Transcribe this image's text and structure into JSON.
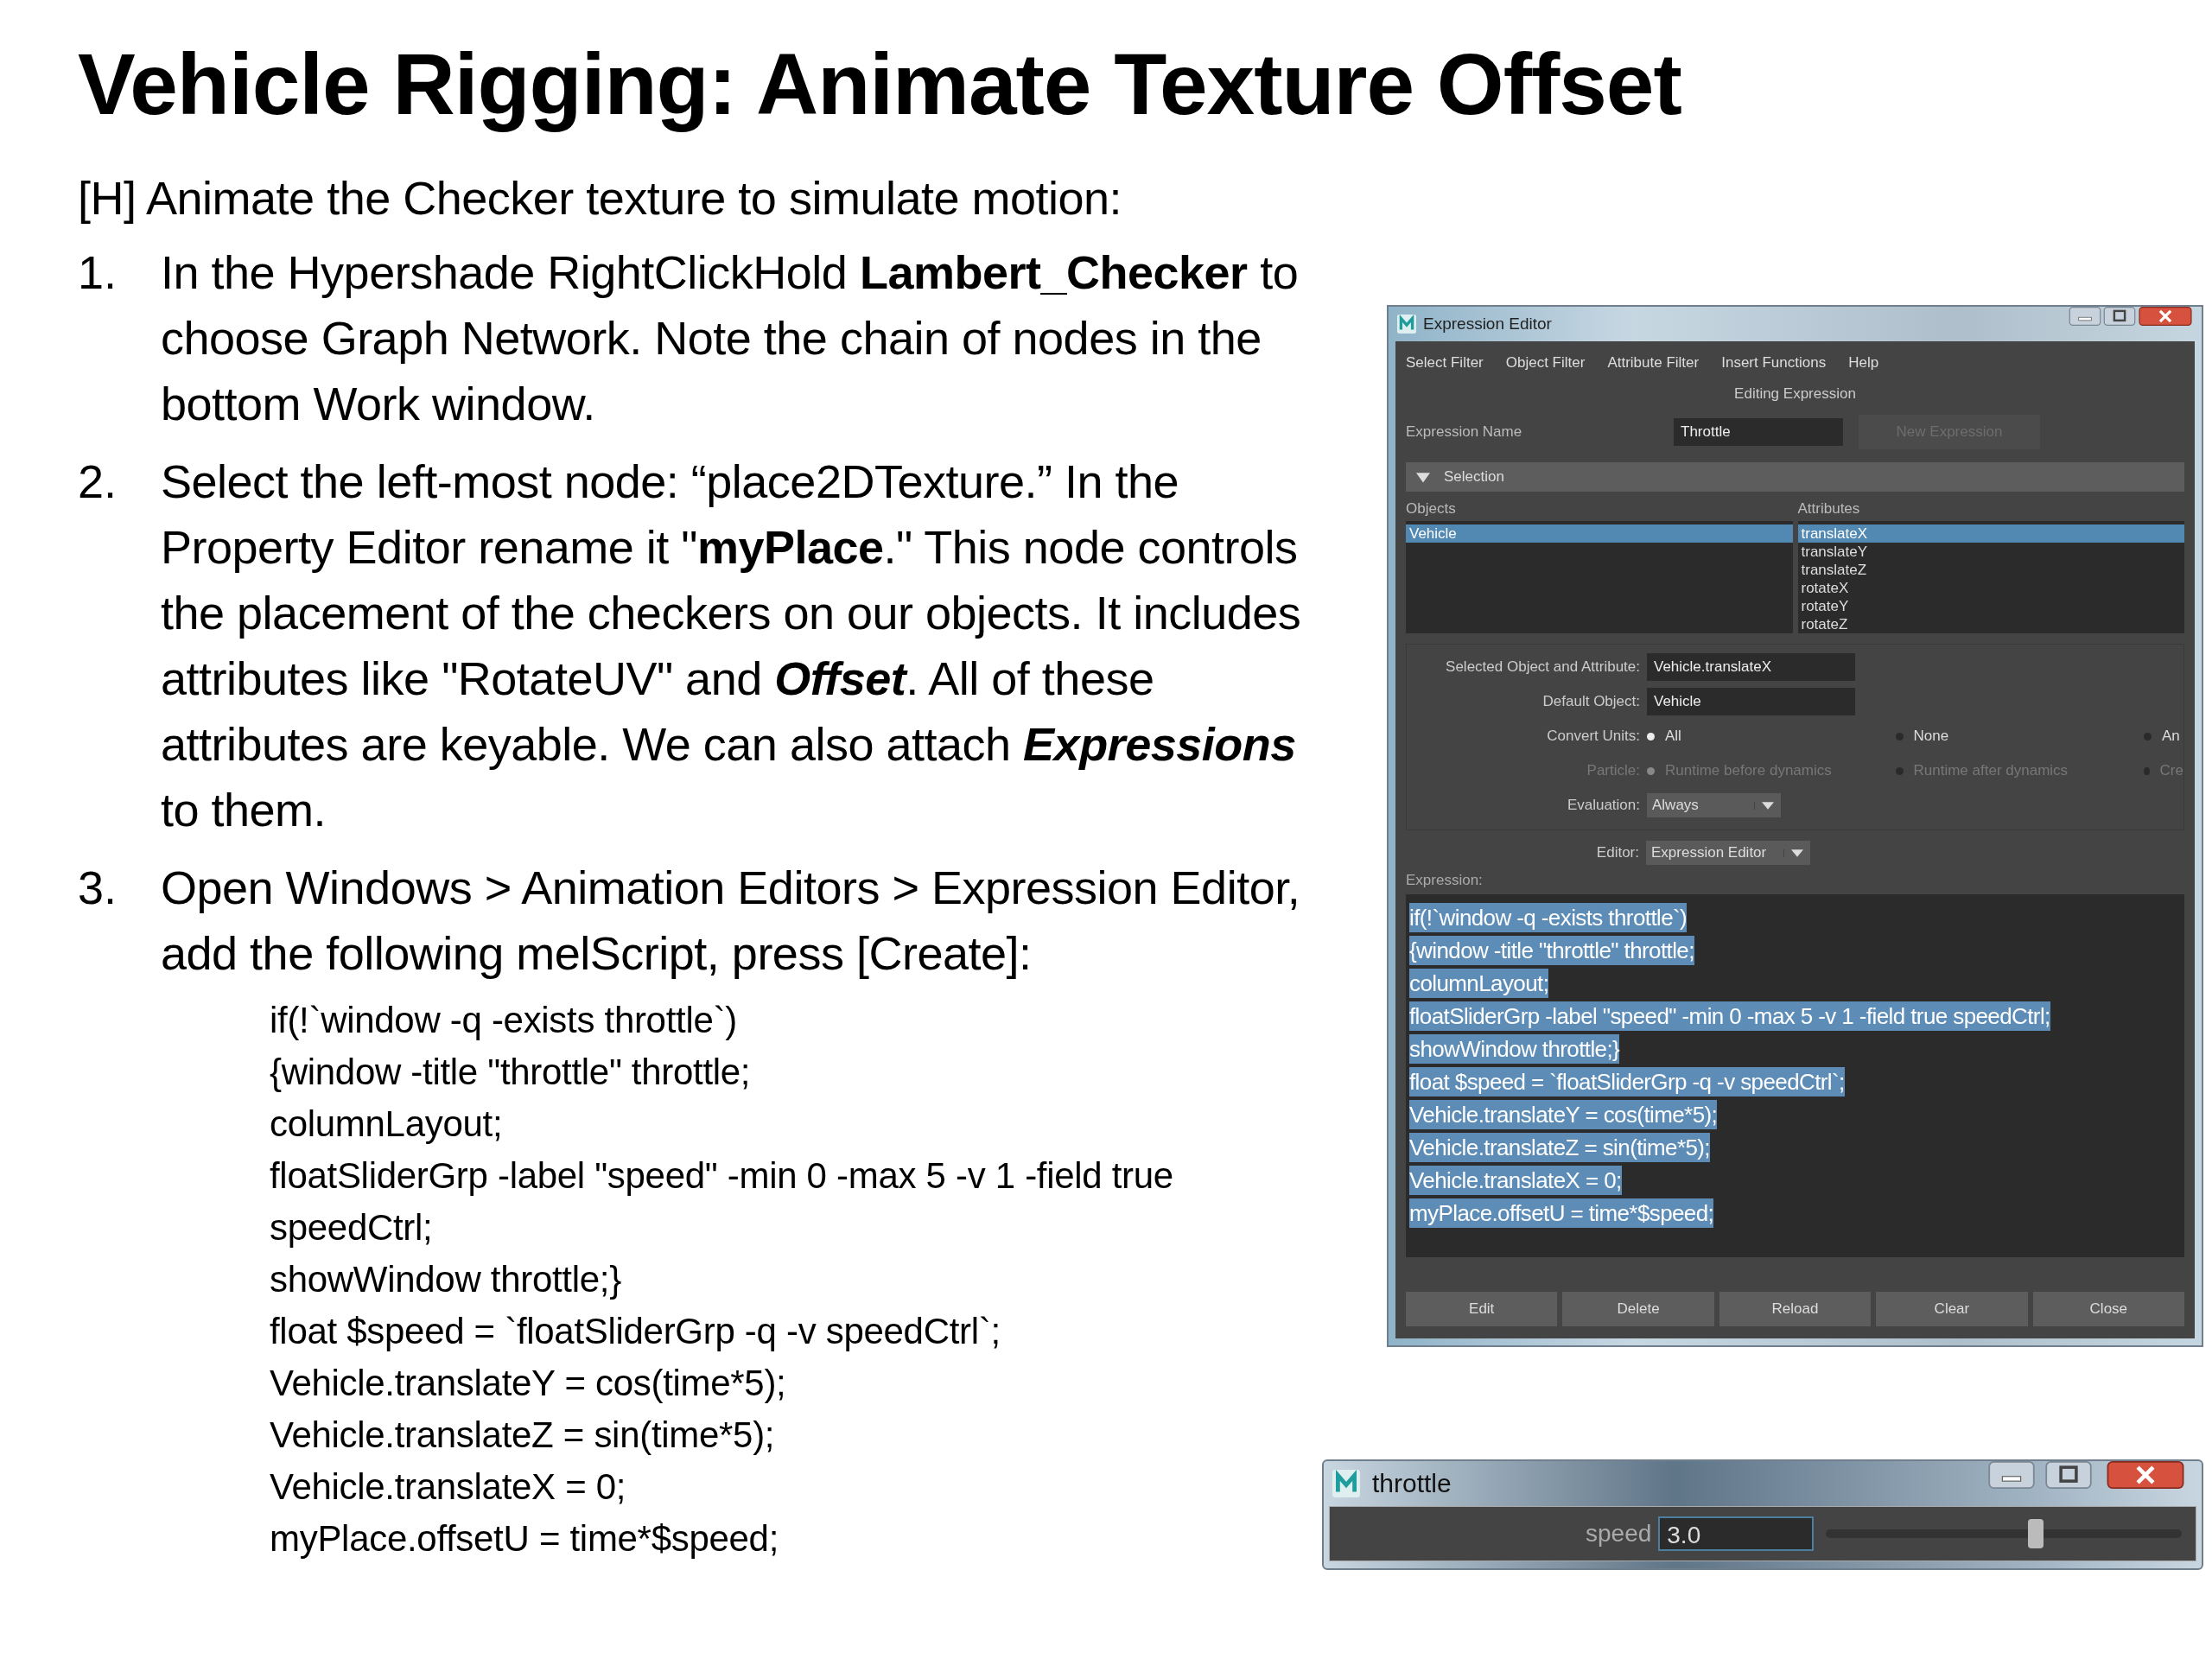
{
  "slide_title": "Vehicle Rigging: Animate Texture Offset",
  "intro": "[H] Animate the Checker texture to simulate motion:",
  "steps": [
    {
      "number": "1.",
      "text": "In the Hypershade RightClickHold **Lambert_Checker** to choose Graph Network. Note the chain of nodes in the bottom Work window."
    },
    {
      "number": "2.",
      "text": "Select the left-most node: “place2DTexture.” In the Property Editor rename it \"**myPlace**.\" This node controls the placement of the checkers on our objects. It includes attributes like \"RotateUV\" and *Offset*. All of these attributes are keyable. We can also attach *Expressions* to them."
    },
    {
      "number": "3.",
      "text": "Open Windows > Animation Editors > Expression Editor, add the following melScript, press [Create]:",
      "code": [
        "if(!`window -q -exists throttle`)",
        "{window -title \"throttle\" throttle;",
        "columnLayout;",
        "floatSliderGrp -label \"speed\" -min 0 -max 5 -v 1 -field true speedCtrl;",
        "showWindow throttle;}",
        "float $speed = `floatSliderGrp -q -v speedCtrl`;",
        "Vehicle.translateY = cos(time*5);",
        "Vehicle.translateZ = sin(time*5);",
        "Vehicle.translateX = 0;",
        "myPlace.offsetU = time*$speed;"
      ]
    }
  ],
  "expression_editor": {
    "title": "Expression Editor",
    "menu": [
      "Select Filter",
      "Object Filter",
      "Attribute Filter",
      "Insert Functions",
      "Help"
    ],
    "heading": "Editing Expression",
    "name_label": "Expression Name",
    "name_value": "Throttle",
    "new_button": {
      "label": "New Expression",
      "disabled": true
    },
    "section": {
      "label": "Selection",
      "expanded": true
    },
    "objects": {
      "label": "Objects",
      "items": [
        {
          "label": "Vehicle",
          "selected": true
        }
      ]
    },
    "attributes": {
      "label": "Attributes",
      "items": [
        {
          "label": "translateX",
          "selected": true
        },
        {
          "label": "translateY",
          "selected": false
        },
        {
          "label": "translateZ",
          "selected": false
        },
        {
          "label": "rotateX",
          "selected": false
        },
        {
          "label": "rotateY",
          "selected": false
        },
        {
          "label": "rotateZ",
          "selected": false
        }
      ]
    },
    "fields": [
      {
        "label": "Selected Object and Attribute:",
        "value": "Vehicle.translateX"
      },
      {
        "label": "Default Object:",
        "value": "Vehicle"
      }
    ],
    "radio_groups": [
      {
        "label": "Convert Units:",
        "disabled": false,
        "options": [
          {
            "label": "All",
            "selected": true
          },
          {
            "label": "None",
            "selected": false
          },
          {
            "label": "An",
            "selected": false
          }
        ]
      },
      {
        "label": "Particle:",
        "disabled": true,
        "options": [
          {
            "label": "Runtime before dynamics",
            "selected": true
          },
          {
            "label": "Runtime after dynamics",
            "selected": false
          },
          {
            "label": "Cre",
            "selected": false
          }
        ]
      }
    ],
    "evaluation": {
      "label": "Evaluation:",
      "value": "Always"
    },
    "editor": {
      "label": "Editor:",
      "value": "Expression Editor"
    },
    "expression_label": "Expression:",
    "expression_lines": [
      "if(!`window -q -exists throttle`)",
      "{window -title \"throttle\" throttle;",
      "columnLayout;",
      "floatSliderGrp -label \"speed\" -min 0 -max 5 -v 1 -field true speedCtrl;",
      "showWindow throttle;}",
      "float $speed = `floatSliderGrp -q -v speedCtrl`;",
      "Vehicle.translateY = cos(time*5);",
      "Vehicle.translateZ = sin(time*5);",
      "Vehicle.translateX = 0;",
      "myPlace.offsetU = time*$speed;"
    ],
    "buttons": [
      "Edit",
      "Delete",
      "Reload",
      "Clear",
      "Close"
    ]
  },
  "throttle_window": {
    "title": "throttle",
    "slider_label": "speed",
    "value": "3.0",
    "level": 0.59
  }
}
